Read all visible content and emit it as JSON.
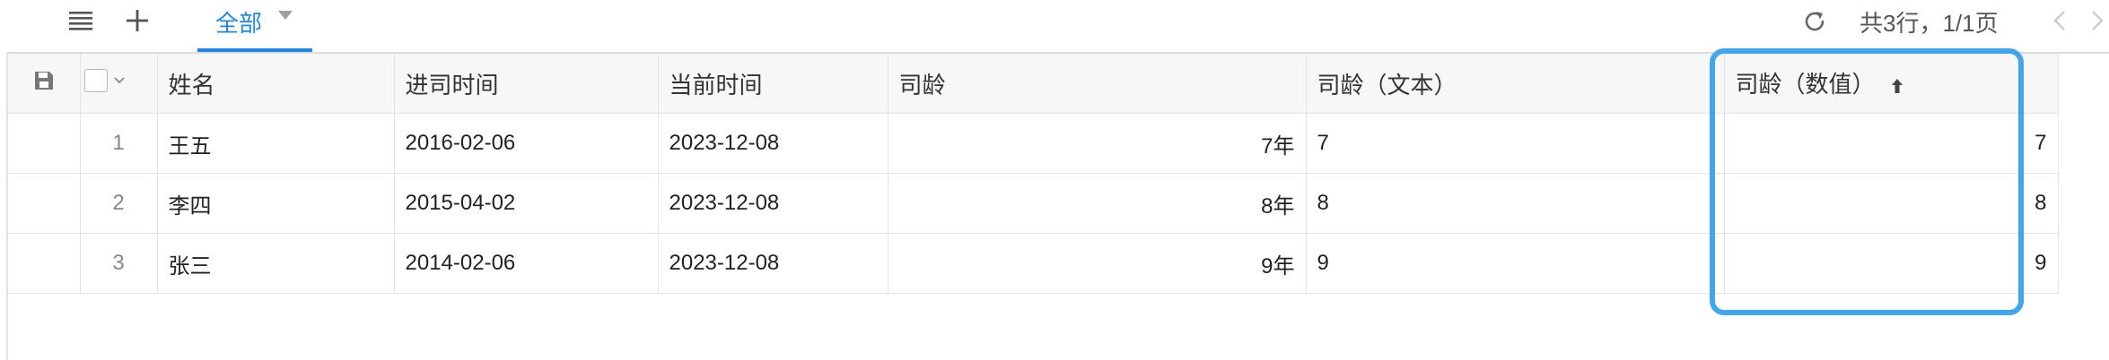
{
  "toolbar": {
    "menu_icon": "menu-lines-icon",
    "add_icon": "plus-icon",
    "tab_label": "全部",
    "refresh_icon": "refresh-icon",
    "pager_text": "共3行，1/1页",
    "prev_icon": "chevron-left-icon",
    "next_icon": "chevron-right-icon"
  },
  "table": {
    "columns": [
      "姓名",
      "进司时间",
      "当前时间",
      "司龄",
      "司龄（文本）",
      "司龄（数值）"
    ],
    "sort_icon": "sort-asc-icon",
    "rows": [
      {
        "index": "1",
        "name": "王五",
        "join": "2016-02-06",
        "now": "2023-12-08",
        "tenure": "7年",
        "tenure_text": "7",
        "tenure_num": "7"
      },
      {
        "index": "2",
        "name": "李四",
        "join": "2015-04-02",
        "now": "2023-12-08",
        "tenure": "8年",
        "tenure_text": "8",
        "tenure_num": "8"
      },
      {
        "index": "3",
        "name": "张三",
        "join": "2014-02-06",
        "now": "2023-12-08",
        "tenure": "9年",
        "tenure_text": "9",
        "tenure_num": "9"
      }
    ]
  },
  "colors": {
    "accent": "#1e88e5",
    "highlight": "#42a5f0"
  }
}
